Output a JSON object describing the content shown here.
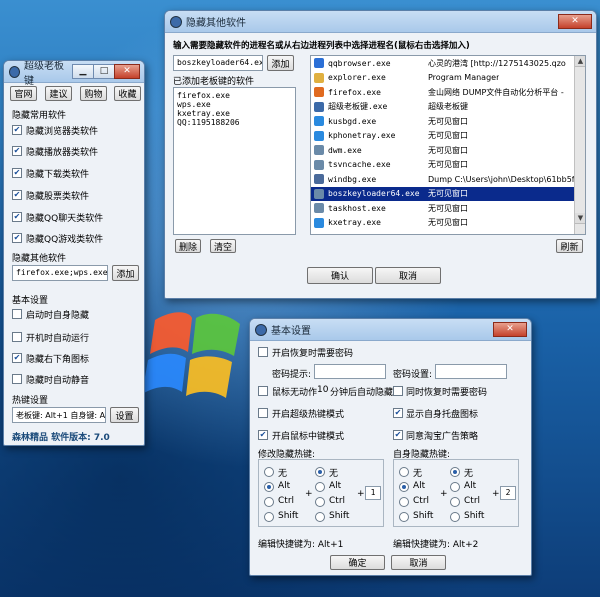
{
  "left_window": {
    "title": "超级老板键",
    "top_buttons": [
      "官网",
      "建议",
      "购物",
      "收藏"
    ],
    "section_hide": "隐藏常用软件",
    "hide_items": [
      {
        "label": "隐藏浏览器类软件",
        "checked": true
      },
      {
        "label": "隐藏播放器类软件",
        "checked": true
      },
      {
        "label": "隐藏下载类软件",
        "checked": true
      },
      {
        "label": "隐藏股票类软件",
        "checked": true
      },
      {
        "label": "隐藏QQ聊天类软件",
        "checked": true
      },
      {
        "label": "隐藏QQ游戏类软件",
        "checked": true
      }
    ],
    "section_other": "隐藏其他软件",
    "other_input": "firefox.exe;wps.exe;k",
    "add_label": "添加",
    "section_basic": "基本设置",
    "basic_items": [
      {
        "label": "启动时自身隐藏",
        "checked": false
      },
      {
        "label": "开机时自动运行",
        "checked": false
      },
      {
        "label": "隐藏右下角图标",
        "checked": true
      },
      {
        "label": "隐藏时自动静音",
        "checked": false
      }
    ],
    "section_hotkey": "热键设置",
    "hotkey_input": "老板键: Alt+1 自身键: A",
    "settings_label": "设置",
    "footer": "森林精品  软件版本: 7.0"
  },
  "hide_window": {
    "title": "隐藏其他软件",
    "instruction": "输入需要隐藏软件的进程名或从右边进程列表中选择进程名(鼠标右击选择加入)",
    "process_input": "boszkeyloader64.exe",
    "add_label": "添加",
    "added_label": "已添加老板键的软件",
    "added_list": [
      "firefox.exe",
      "wps.exe",
      "kxetray.exe",
      "QQ:1195188206"
    ],
    "delete_label": "删除",
    "clear_label": "清空",
    "refresh_label": "刷新",
    "ok_label": "确认",
    "cancel_label": "取消",
    "processes": [
      {
        "name": "qqbrowser.exe",
        "title": "心灵的港湾 [http://1275143025.qzo",
        "icon": "#2b6fd6"
      },
      {
        "name": "explorer.exe",
        "title": "Program Manager",
        "icon": "#e0b040"
      },
      {
        "name": "firefox.exe",
        "title": "金山网络 DUMP文件自动化分析平台 -",
        "icon": "#e06a20"
      },
      {
        "name": "超级老板键.exe",
        "title": "超级老板键",
        "icon": "#3c6aa8"
      },
      {
        "name": "kusbgd.exe",
        "title": "无可见窗口",
        "icon": "#2a8adf"
      },
      {
        "name": "kphonetray.exe",
        "title": "无可见窗口",
        "icon": "#2a8adf"
      },
      {
        "name": "dwm.exe",
        "title": "无可见窗口",
        "icon": "#6a8aa8"
      },
      {
        "name": "tsvncache.exe",
        "title": "无可见窗口",
        "icon": "#6a8aa8"
      },
      {
        "name": "windbg.exe",
        "title": "Dump C:\\Users\\john\\Desktop\\61bb5f",
        "icon": "#4a6a9a"
      },
      {
        "name": "boszkeyloader64.exe",
        "title": "无可见窗口",
        "icon": "#6a8aa8",
        "selected": true
      },
      {
        "name": "taskhost.exe",
        "title": "无可见窗口",
        "icon": "#6a8aa8"
      },
      {
        "name": "kxetray.exe",
        "title": "无可见窗口",
        "icon": "#2a8adf"
      }
    ]
  },
  "basic_window": {
    "title": "基本设置",
    "restore_pwd": {
      "label": "开启恢复时需要密码",
      "checked": false
    },
    "pwd_hint_label": "密码提示:",
    "pwd_hint_value": "",
    "pwd_set_label": "密码设置:",
    "pwd_set_value": "",
    "mouse_idle": {
      "label_pre": "鼠标无动作",
      "minutes": "10",
      "label_post": "分钟后自动隐藏",
      "checked": false
    },
    "restore_pwd2": {
      "label": "同时恢复时需要密码",
      "checked": false
    },
    "super_hotkey": {
      "label": "开启超级热键模式",
      "checked": false
    },
    "show_tray": {
      "label": "显示自身托盘图标",
      "checked": true
    },
    "mouse_middle": {
      "label": "开启鼠标中键模式",
      "checked": true
    },
    "agree_ad": {
      "label": "同意淘宝广告策略",
      "checked": true
    },
    "hide_hotkey_title": "修改隐藏热键:",
    "self_hotkey_title": "自身隐藏热键:",
    "mod_none": "无",
    "mod_alt": "Alt",
    "mod_ctrl": "Ctrl",
    "mod_shift": "Shift",
    "plus": "+",
    "hide_key": "1",
    "self_key": "2",
    "hide_result": "编辑快捷键为: Alt+1",
    "self_result": "编辑快捷键为: Alt+2",
    "ok_label": "确定",
    "cancel_label": "取消"
  },
  "colors": {
    "selection": "#0a2a8c",
    "title_bar": "#b8d4f0"
  }
}
